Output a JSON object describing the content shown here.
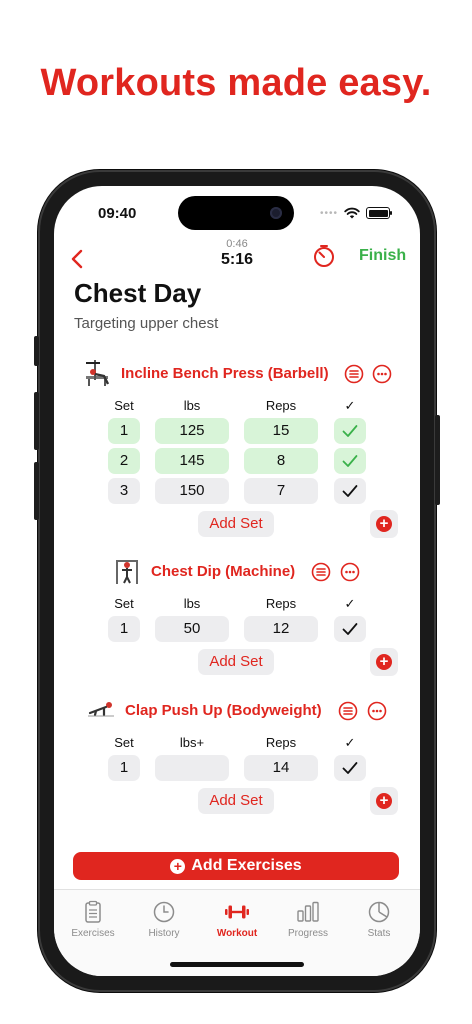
{
  "headline": "Workouts made easy.",
  "status_bar": {
    "time": "09:40",
    "icons": [
      "signal-dots",
      "wifi-icon",
      "battery-icon"
    ]
  },
  "header": {
    "elapsed_small": "0:46",
    "elapsed_big": "5:16",
    "finish_label": "Finish",
    "icons": [
      "back-chevron-icon",
      "rest-timer-icon"
    ]
  },
  "workout": {
    "title": "Chest Day",
    "subtitle": "Targeting upper chest"
  },
  "exercises": [
    {
      "name": "Incline Bench Press (Barbell)",
      "columns": [
        "Set",
        "lbs",
        "Reps",
        "✓"
      ],
      "sets": [
        {
          "set": "1",
          "weight": "125",
          "reps": "15",
          "done": true
        },
        {
          "set": "2",
          "weight": "145",
          "reps": "8",
          "done": true
        },
        {
          "set": "3",
          "weight": "150",
          "reps": "7",
          "done": false
        }
      ],
      "add_set_label": "Add Set"
    },
    {
      "name": "Chest Dip (Machine)",
      "columns": [
        "Set",
        "lbs",
        "Reps",
        "✓"
      ],
      "sets": [
        {
          "set": "1",
          "weight": "50",
          "reps": "12",
          "done": false
        }
      ],
      "add_set_label": "Add Set"
    },
    {
      "name": "Clap Push Up (Bodyweight)",
      "columns": [
        "Set",
        "lbs+",
        "Reps",
        "✓"
      ],
      "sets": [
        {
          "set": "1",
          "weight": "",
          "reps": "14",
          "done": false
        }
      ],
      "add_set_label": "Add Set"
    }
  ],
  "add_exercises_label": "Add Exercises",
  "tabs": [
    {
      "label": "Exercises",
      "icon": "clipboard-icon",
      "active": false
    },
    {
      "label": "History",
      "icon": "clock-icon",
      "active": false
    },
    {
      "label": "Workout",
      "icon": "dumbbell-icon",
      "active": true
    },
    {
      "label": "Progress",
      "icon": "bar-chart-icon",
      "active": false
    },
    {
      "label": "Stats",
      "icon": "pie-chart-icon",
      "active": false
    }
  ],
  "colors": {
    "accent": "#e0261f",
    "success": "#3ab14a",
    "done_fill": "#d8f4d8",
    "cell_fill": "#ededef"
  }
}
